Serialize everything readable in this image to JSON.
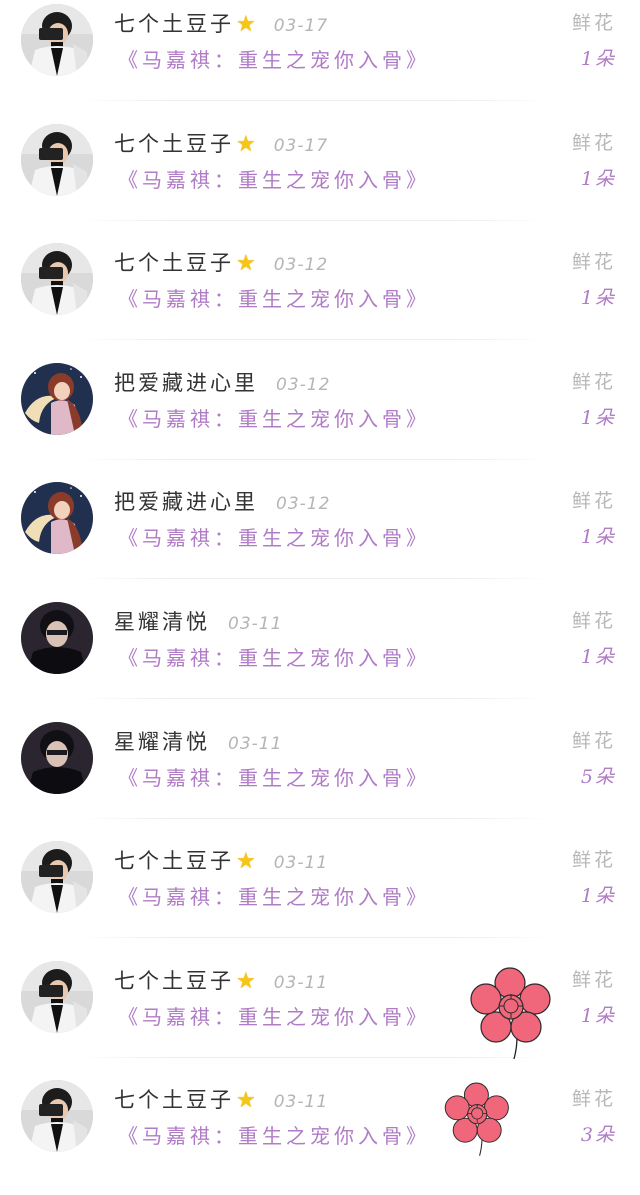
{
  "records": [
    {
      "user": "七个土豆子",
      "star": true,
      "avatar": "boy-mirror-selfie",
      "date": "03-17",
      "book": "《马嘉祺：重生之宠你入骨》",
      "gift": "鲜花",
      "count": "1朵"
    },
    {
      "user": "七个土豆子",
      "star": true,
      "avatar": "boy-mirror-selfie",
      "date": "03-17",
      "book": "《马嘉祺：重生之宠你入骨》",
      "gift": "鲜花",
      "count": "1朵"
    },
    {
      "user": "七个土豆子",
      "star": true,
      "avatar": "boy-mirror-selfie",
      "date": "03-12",
      "book": "《马嘉祺：重生之宠你入骨》",
      "gift": "鲜花",
      "count": "1朵"
    },
    {
      "user": "把爱藏进心里",
      "star": false,
      "avatar": "anime-girl-moon",
      "date": "03-12",
      "book": "《马嘉祺：重生之宠你入骨》",
      "gift": "鲜花",
      "count": "1朵"
    },
    {
      "user": "把爱藏进心里",
      "star": false,
      "avatar": "anime-girl-moon",
      "date": "03-12",
      "book": "《马嘉祺：重生之宠你入骨》",
      "gift": "鲜花",
      "count": "1朵"
    },
    {
      "user": "星耀清悦",
      "star": false,
      "avatar": "boy-dark-portrait",
      "date": "03-11",
      "book": "《马嘉祺：重生之宠你入骨》",
      "gift": "鲜花",
      "count": "1朵"
    },
    {
      "user": "星耀清悦",
      "star": false,
      "avatar": "boy-dark-portrait",
      "date": "03-11",
      "book": "《马嘉祺：重生之宠你入骨》",
      "gift": "鲜花",
      "count": "5朵"
    },
    {
      "user": "七个土豆子",
      "star": true,
      "avatar": "boy-mirror-selfie",
      "date": "03-11",
      "book": "《马嘉祺：重生之宠你入骨》",
      "gift": "鲜花",
      "count": "1朵"
    },
    {
      "user": "七个土豆子",
      "star": true,
      "avatar": "boy-mirror-selfie",
      "date": "03-11",
      "book": "《马嘉祺：重生之宠你入骨》",
      "gift": "鲜花",
      "count": "1朵"
    },
    {
      "user": "七个土豆子",
      "star": true,
      "avatar": "boy-mirror-selfie",
      "date": "03-11",
      "book": "《马嘉祺：重生之宠你入骨》",
      "gift": "鲜花",
      "count": "3朵"
    }
  ],
  "decor": {
    "star_icon": "star-icon",
    "flower_icon": "flower-sticker-icon",
    "colors": {
      "username": "#333333",
      "date": "#b5b5b5",
      "book_title": "#b07cc6",
      "gift_label": "#b8b8b8",
      "gift_count": "#b07cc6",
      "flower": "#f0667a",
      "star": "#f5c518"
    }
  }
}
